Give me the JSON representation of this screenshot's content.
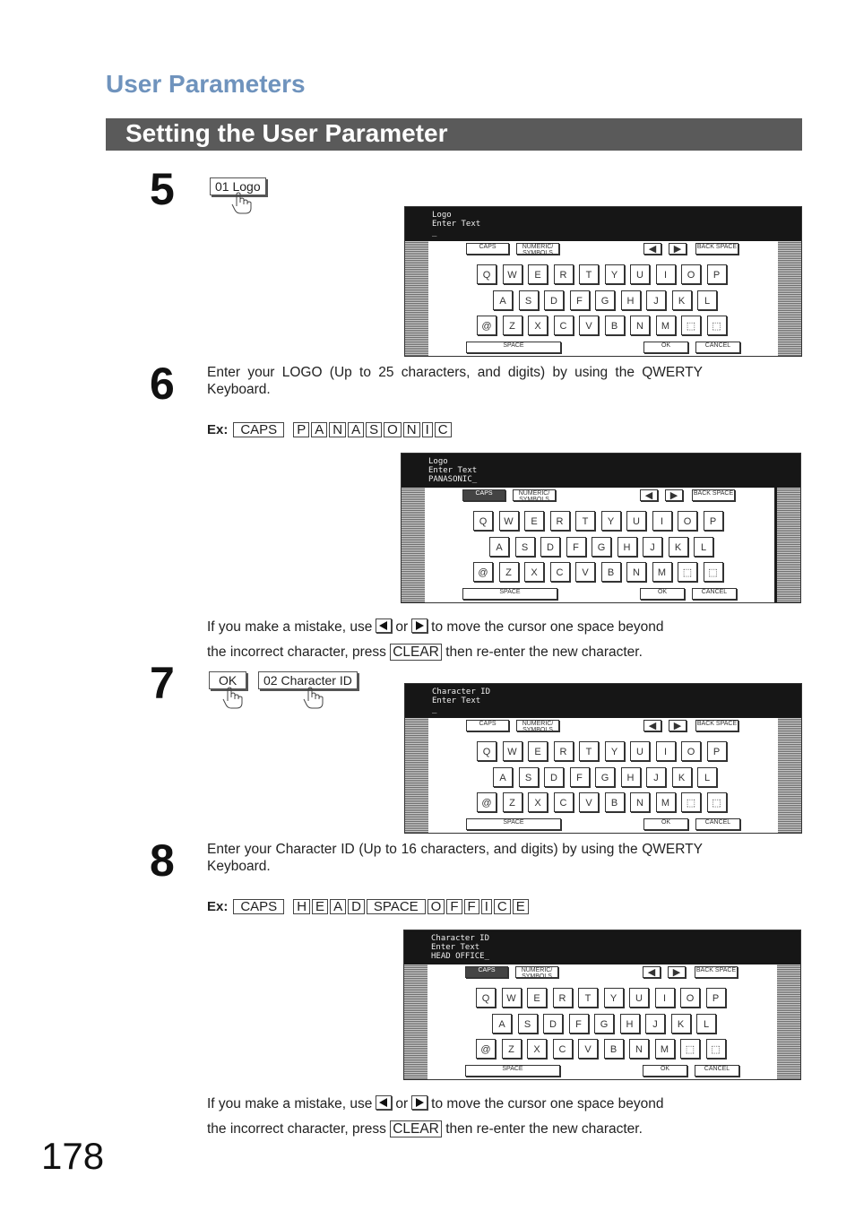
{
  "header": {
    "section": "User Parameters",
    "title": "Setting the User Parameter"
  },
  "step5": {
    "num": "5",
    "button": "01 Logo"
  },
  "panel1": {
    "lines": [
      "Logo",
      "Enter Text",
      "_"
    ]
  },
  "step6": {
    "num": "6",
    "text": "Enter your LOGO (Up to 25 characters, and digits) by using the QWERTY Keyboard.",
    "ex_label": "Ex:",
    "ex_keys": [
      "CAPS",
      "P",
      "A",
      "N",
      "A",
      "S",
      "O",
      "N",
      "I",
      "C"
    ]
  },
  "panel2": {
    "lines": [
      "Logo",
      "Enter Text",
      "PANASONIC_"
    ]
  },
  "mistake": {
    "p1": "If you make a mistake, use",
    "or": "or",
    "p2": "to move the cursor one space beyond",
    "p3": "the incorrect character, press",
    "clear": "CLEAR",
    "p4": "then re-enter the new character."
  },
  "step7": {
    "num": "7",
    "ok": "OK",
    "button": "02 Character ID"
  },
  "panel3": {
    "lines": [
      "Character ID",
      "Enter Text",
      "_"
    ]
  },
  "step8": {
    "num": "8",
    "text": "Enter your Character ID (Up to 16 characters, and digits) by using the QWERTY Keyboard.",
    "ex_label": "Ex:",
    "ex_keys": [
      "CAPS",
      "H",
      "E",
      "A",
      "D",
      "SPACE",
      "O",
      "F",
      "F",
      "I",
      "C",
      "E"
    ]
  },
  "panel4": {
    "lines": [
      "Character ID",
      "Enter Text",
      "HEAD OFFICE_"
    ]
  },
  "keyboard": {
    "caps": "CAPS",
    "numeric": "NUMERIC/ SYMBOLS",
    "back": "BACK SPACE",
    "row1": [
      "Q",
      "W",
      "E",
      "R",
      "T",
      "Y",
      "U",
      "I",
      "O",
      "P"
    ],
    "row2": [
      "A",
      "S",
      "D",
      "F",
      "G",
      "H",
      "J",
      "K",
      "L"
    ],
    "row3": [
      "@",
      "Z",
      "X",
      "C",
      "V",
      "B",
      "N",
      "M",
      "⬚",
      "⬚"
    ],
    "space": "SPACE",
    "ok": "OK",
    "cancel": "CANCEL"
  },
  "page_number": "178"
}
